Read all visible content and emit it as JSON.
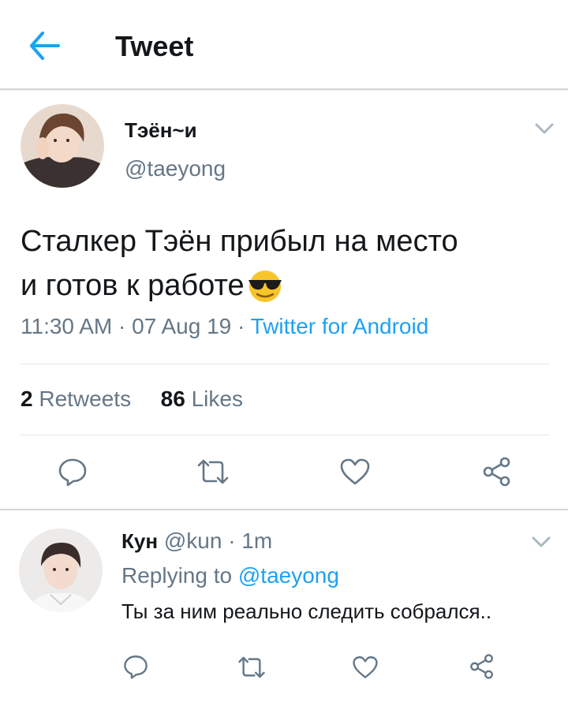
{
  "header": {
    "title": "Tweet"
  },
  "tweet": {
    "author_name": "Тэён~и",
    "author_handle": "@taeyong",
    "text_line1": "Сталкер Тэён прибыл на место",
    "text_line2": "и готов к работе",
    "emoji": "sunglasses-emoji",
    "time": "11:30 AM",
    "date": "07 Aug 19",
    "separator": "·",
    "source": "Twitter for Android",
    "retweets_count": "2",
    "retweets_label": "Retweets",
    "likes_count": "86",
    "likes_label": "Likes"
  },
  "reply": {
    "author_name": "Кун",
    "author_handle": "@kun",
    "separator": "·",
    "time": "1m",
    "replying_to_label": "Replying to",
    "replying_to_handle": "@taeyong",
    "text": "Ты за ним реально следить собрался.."
  },
  "colors": {
    "accent": "#1da1f2",
    "secondary_text": "#657786",
    "icon": "#657786",
    "divider": "#e1e8ed"
  }
}
